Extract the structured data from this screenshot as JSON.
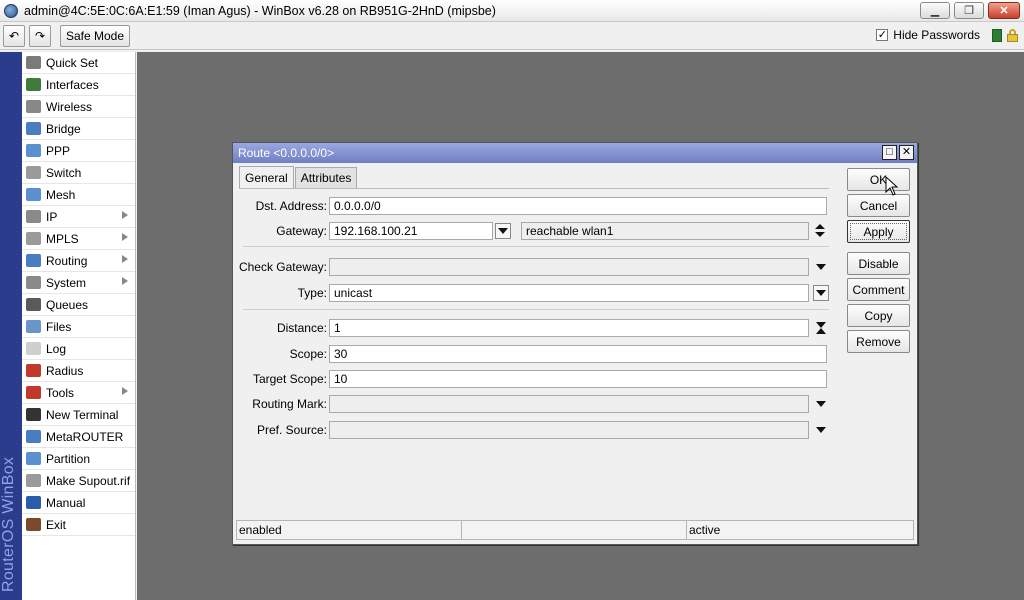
{
  "window": {
    "title": "admin@4C:5E:0C:6A:E1:59 (Iman Agus) - WinBox v6.28 on RB951G-2HnD (mipsbe)",
    "minimize": "▁",
    "maximize": "❐",
    "close": "✕"
  },
  "toolbar": {
    "undo": "↶",
    "redo": "↷",
    "safe_mode": "Safe Mode",
    "hide_passwords_label": "Hide Passwords",
    "hide_passwords_checked": "✓"
  },
  "brand": {
    "text": "RouterOS WinBox"
  },
  "menu": {
    "items": [
      {
        "label": "Quick Set",
        "icon": "quickset-icon",
        "color": "#7a7a7a",
        "submenu": false
      },
      {
        "label": "Interfaces",
        "icon": "interfaces-icon",
        "color": "#3f7a3f",
        "submenu": false
      },
      {
        "label": "Wireless",
        "icon": "wireless-icon",
        "color": "#888888",
        "submenu": false
      },
      {
        "label": "Bridge",
        "icon": "bridge-icon",
        "color": "#4a7cc0",
        "submenu": false
      },
      {
        "label": "PPP",
        "icon": "ppp-icon",
        "color": "#5a8fd0",
        "submenu": false
      },
      {
        "label": "Switch",
        "icon": "switch-icon",
        "color": "#9a9a9a",
        "submenu": false
      },
      {
        "label": "Mesh",
        "icon": "mesh-icon",
        "color": "#5a8fd0",
        "submenu": false
      },
      {
        "label": "IP",
        "icon": "ip-icon",
        "color": "#8a8a8a",
        "submenu": true
      },
      {
        "label": "MPLS",
        "icon": "mpls-icon",
        "color": "#9a9a9a",
        "submenu": true
      },
      {
        "label": "Routing",
        "icon": "routing-icon",
        "color": "#4a7cc0",
        "submenu": true
      },
      {
        "label": "System",
        "icon": "system-icon",
        "color": "#8a8a8a",
        "submenu": true
      },
      {
        "label": "Queues",
        "icon": "queues-icon",
        "color": "#5a5a5a",
        "submenu": false
      },
      {
        "label": "Files",
        "icon": "files-icon",
        "color": "#6a95c8",
        "submenu": false
      },
      {
        "label": "Log",
        "icon": "log-icon",
        "color": "#cfcfcf",
        "submenu": false
      },
      {
        "label": "Radius",
        "icon": "radius-icon",
        "color": "#c0392b",
        "submenu": false
      },
      {
        "label": "Tools",
        "icon": "tools-icon",
        "color": "#c0392b",
        "submenu": true
      },
      {
        "label": "New Terminal",
        "icon": "terminal-icon",
        "color": "#333333",
        "submenu": false
      },
      {
        "label": "MetaROUTER",
        "icon": "metarouter-icon",
        "color": "#4a7cc0",
        "submenu": false
      },
      {
        "label": "Partition",
        "icon": "partition-icon",
        "color": "#5a8fd0",
        "submenu": false
      },
      {
        "label": "Make Supout.rif",
        "icon": "supout-icon",
        "color": "#9a9a9a",
        "submenu": false
      },
      {
        "label": "Manual",
        "icon": "manual-icon",
        "color": "#2a5cab",
        "submenu": false
      },
      {
        "label": "Exit",
        "icon": "exit-icon",
        "color": "#7a4a2a",
        "submenu": false
      }
    ]
  },
  "dialog": {
    "title": "Route <0.0.0.0/0>",
    "restore": "□",
    "close": "✕",
    "tabs": [
      "General",
      "Attributes"
    ],
    "fields": {
      "dst_address": {
        "label": "Dst. Address:",
        "value": "0.0.0.0/0"
      },
      "gateway": {
        "label": "Gateway:",
        "value": "192.168.100.21",
        "state": "reachable wlan1"
      },
      "check_gateway": {
        "label": "Check Gateway:",
        "value": ""
      },
      "type": {
        "label": "Type:",
        "value": "unicast"
      },
      "distance": {
        "label": "Distance:",
        "value": "1"
      },
      "scope": {
        "label": "Scope:",
        "value": "30"
      },
      "target_scope": {
        "label": "Target Scope:",
        "value": "10"
      },
      "routing_mark": {
        "label": "Routing Mark:",
        "value": ""
      },
      "pref_source": {
        "label": "Pref. Source:",
        "value": ""
      }
    },
    "buttons": {
      "ok": "OK",
      "cancel": "Cancel",
      "apply": "Apply",
      "disable": "Disable",
      "comment": "Comment",
      "copy": "Copy",
      "remove": "Remove"
    },
    "status": [
      "enabled",
      "",
      "active"
    ]
  }
}
